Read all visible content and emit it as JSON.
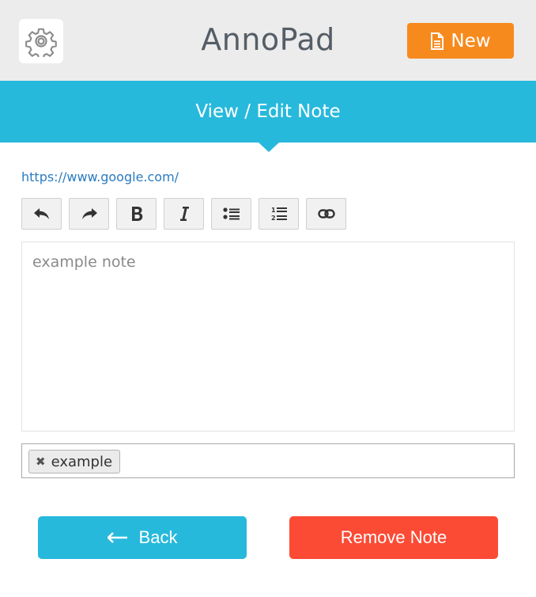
{
  "header": {
    "title": "AnnoPad",
    "settings_icon": "gear-icon",
    "new_label": "New",
    "new_icon": "document-icon"
  },
  "banner": {
    "title": "View / Edit Note"
  },
  "note": {
    "url": "https://www.google.com/",
    "text": "example note"
  },
  "toolbar": {
    "buttons": [
      "undo-icon",
      "redo-icon",
      "bold-icon",
      "italic-icon",
      "bullet-list-icon",
      "numbered-list-icon",
      "link-icon"
    ]
  },
  "tags": [
    {
      "label": "example"
    }
  ],
  "actions": {
    "back_label": "Back",
    "remove_label": "Remove Note"
  },
  "colors": {
    "header_bg": "#ececec",
    "accent": "#27b9dc",
    "new_button": "#f78a1d",
    "danger": "#fb4b35",
    "link": "#2a7bc0"
  }
}
